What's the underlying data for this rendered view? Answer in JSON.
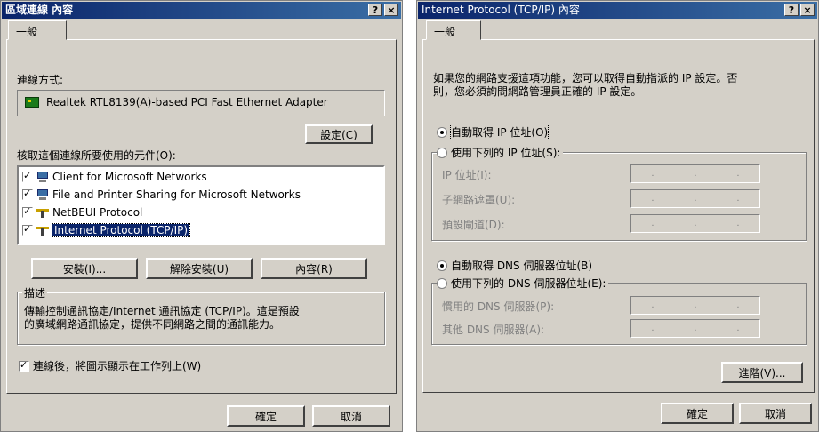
{
  "left": {
    "title": "區域連線 內容",
    "title_help": "?",
    "title_close": "×",
    "tab_general": "一般",
    "connect_using_label": "連線方式:",
    "adapter_name": "Realtek RTL8139(A)-based PCI Fast Ethernet Adapter",
    "configure_button": "設定(C)",
    "components_label": "核取這個連線所要使用的元件(O):",
    "components": [
      {
        "label": "Client for Microsoft Networks",
        "icon": "network-client-icon",
        "checked": true
      },
      {
        "label": "File and Printer Sharing for Microsoft Networks",
        "icon": "file-printer-sharing-icon",
        "checked": true
      },
      {
        "label": "NetBEUI Protocol",
        "icon": "protocol-icon",
        "checked": true
      },
      {
        "label": "Internet Protocol (TCP/IP)",
        "icon": "protocol-icon",
        "checked": true,
        "selected": true
      }
    ],
    "install_button": "安裝(I)...",
    "uninstall_button": "解除安裝(U)",
    "properties_button": "內容(R)",
    "description_group": "描述",
    "description_text_1": "傳輸控制通訊協定/Internet 通訊協定 (TCP/IP)。這是預設",
    "description_text_2": "的廣域網路通訊協定，提供不同網路之間的通訊能力。",
    "show_icon_label": "連線後，將圖示顯示在工作列上(W)",
    "ok_button": "確定",
    "cancel_button": "取消"
  },
  "right": {
    "title": "Internet Protocol (TCP/IP) 內容",
    "title_help": "?",
    "title_close": "×",
    "tab_general": "一般",
    "intro_line_1": "如果您的網路支援這項功能，您可以取得自動指派的 IP 設定。否",
    "intro_line_2": "則，您必須詢問網路管理員正確的 IP 設定。",
    "auto_ip_radio": "自動取得 IP 位址(O)",
    "manual_ip_radio": "使用下列的 IP 位址(S):",
    "ip_address_label": "IP 位址(I):",
    "subnet_label": "子網路遮罩(U):",
    "gateway_label": "預設閘道(D):",
    "auto_dns_radio": "自動取得 DNS 伺服器位址(B)",
    "manual_dns_radio": "使用下列的 DNS 伺服器位址(E):",
    "preferred_dns_label": "慣用的 DNS 伺服器(P):",
    "alternate_dns_label": "其他 DNS 伺服器(A):",
    "advanced_button": "進階(V)...",
    "ok_button": "確定",
    "cancel_button": "取消",
    "ip_dot": "."
  }
}
